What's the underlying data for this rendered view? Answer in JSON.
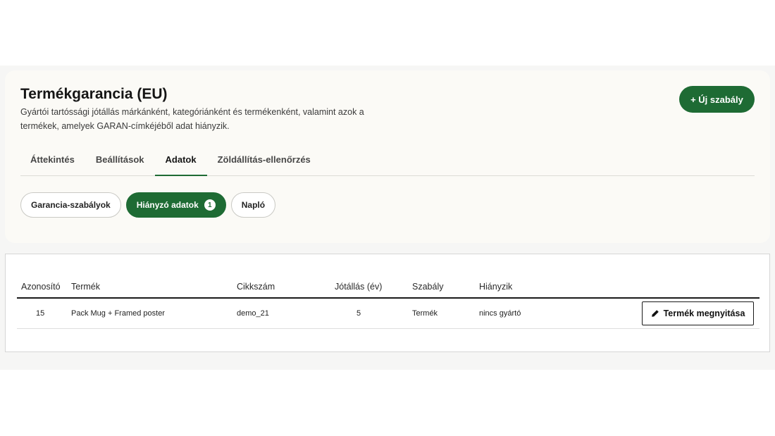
{
  "header": {
    "title": "Termékgarancia (EU)",
    "description": "Gyártói tartóssági jótállás márkánként, kategóriánként és termékenként, valamint azok a termékek, amelyek GARAN-címkéjéből adat hiányzik.",
    "new_rule_label": "+ Új szabály"
  },
  "tabs": [
    {
      "label": "Áttekintés"
    },
    {
      "label": "Beállítások"
    },
    {
      "label": "Adatok"
    },
    {
      "label": "Zöldállítás-ellenőrzés"
    }
  ],
  "pills": [
    {
      "label": "Garancia-szabályok"
    },
    {
      "label": "Hiányzó adatok",
      "badge": "1"
    },
    {
      "label": "Napló"
    }
  ],
  "table": {
    "columns": [
      "Azonosító",
      "Termék",
      "Cikkszám",
      "Jótállás (év)",
      "Szabály",
      "Hiányzik"
    ],
    "rows": [
      {
        "id": "15",
        "product": "Pack Mug + Framed poster",
        "sku": "demo_21",
        "warranty": "5",
        "rule": "Termék",
        "missing": "nincs gyártó",
        "action": "Termék megnyitása"
      }
    ]
  },
  "colors": {
    "accent": "#1e6b34",
    "card_bg": "#fbfaf6",
    "band_bg": "#f6f6f5"
  },
  "icons": {
    "action_icon": "pencil-icon"
  }
}
